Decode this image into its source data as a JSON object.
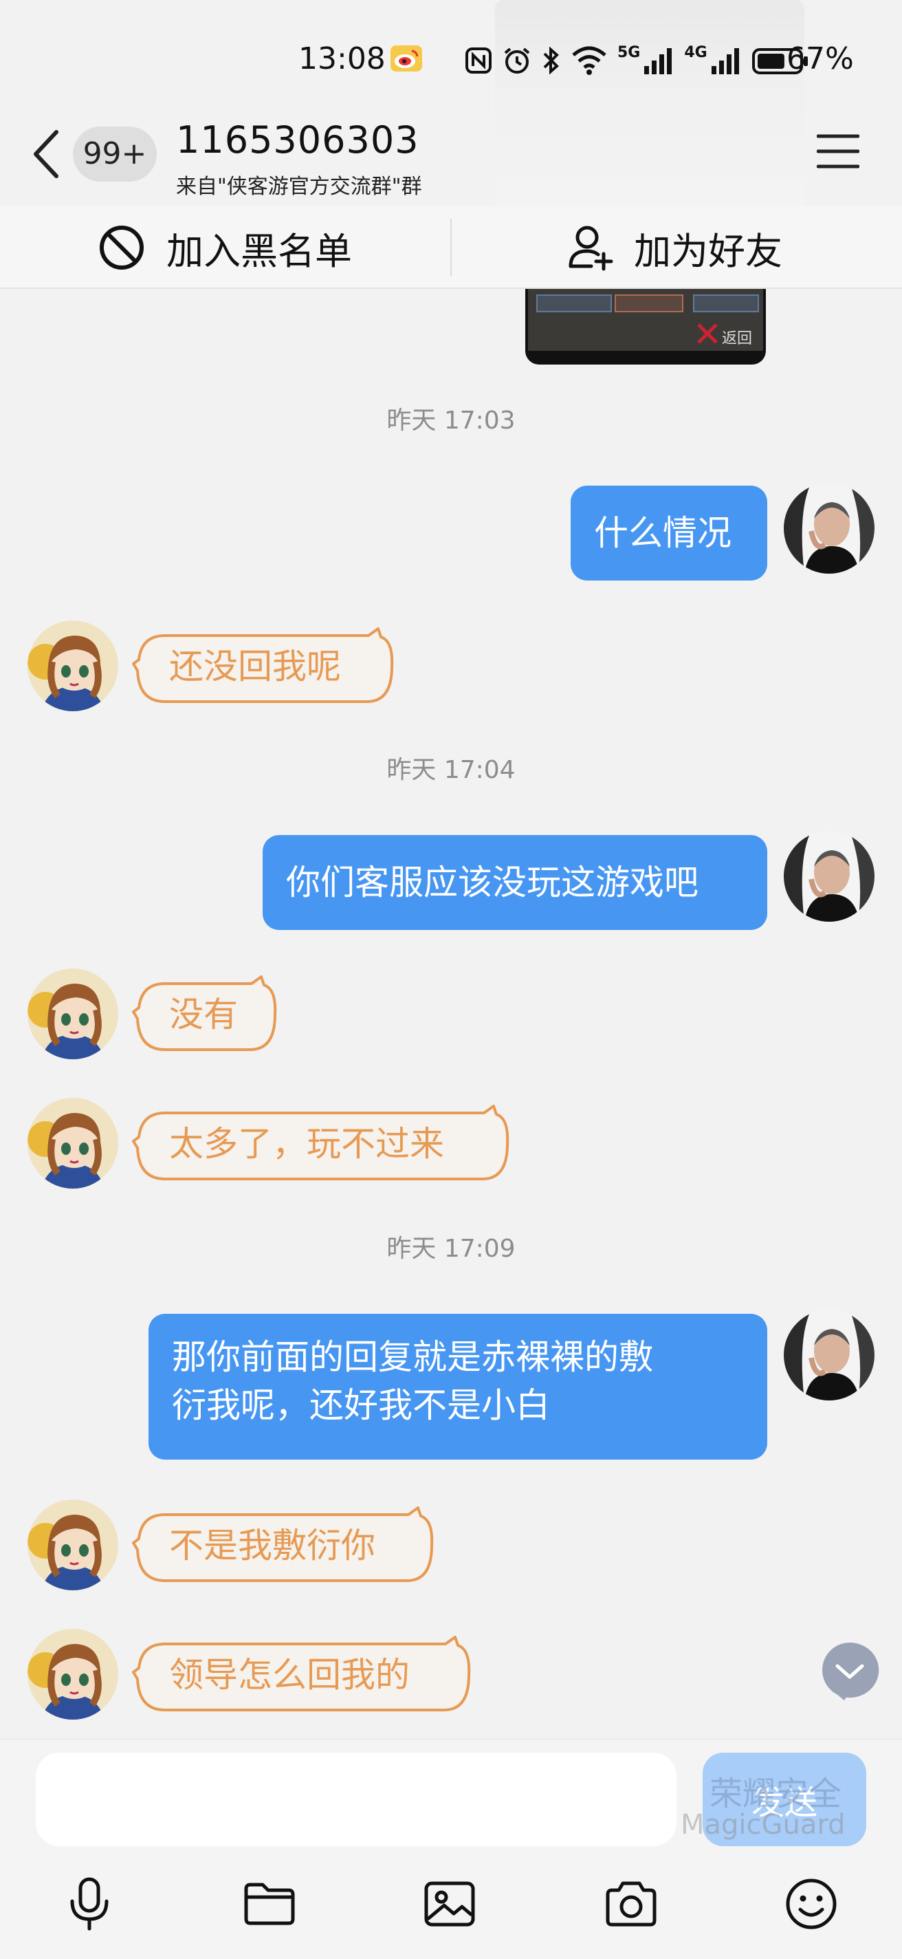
{
  "status_bar": {
    "time": "13:08",
    "net_5g": "5G",
    "net_4g": "4G",
    "battery_percent": "67%",
    "battery_level": 0.67
  },
  "header": {
    "unread_badge": "99+",
    "contact_name": "1165306303",
    "contact_source": "来自\"侠客游官方交流群\"群"
  },
  "actions": {
    "block_label": "加入黑名单",
    "add_friend_label": "加为好友"
  },
  "messages": [
    {
      "type": "timestamp",
      "text": "昨天 17:03"
    },
    {
      "type": "out",
      "text": "什么情况"
    },
    {
      "type": "in",
      "text": "还没回我呢"
    },
    {
      "type": "timestamp",
      "text": "昨天 17:04"
    },
    {
      "type": "out",
      "text": "你们客服应该没玩这游戏吧"
    },
    {
      "type": "in",
      "text": "没有"
    },
    {
      "type": "in",
      "text": "太多了，玩不过来"
    },
    {
      "type": "timestamp",
      "text": "昨天 17:09"
    },
    {
      "type": "out",
      "lines": [
        "那你前面的回复就是赤裸裸的敷",
        "衍我呢，还好我不是小白"
      ]
    },
    {
      "type": "in",
      "text": "不是我敷衍你"
    },
    {
      "type": "in",
      "text": "领导怎么回我的"
    }
  ],
  "thumbnail_caption": "返回",
  "input": {
    "value": "",
    "placeholder": "",
    "send_label": "发送"
  },
  "watermark": {
    "line1": "荣耀安全",
    "line2": "MagicGuard"
  },
  "toolbar": [
    "microphone-icon",
    "folder-icon",
    "image-icon",
    "camera-icon",
    "emoji-icon"
  ],
  "colors": {
    "outgoing_bubble": "#4797f2",
    "incoming_text": "#e69a53",
    "send_button": "#a8cdf8",
    "background": "#f2f2f2"
  }
}
